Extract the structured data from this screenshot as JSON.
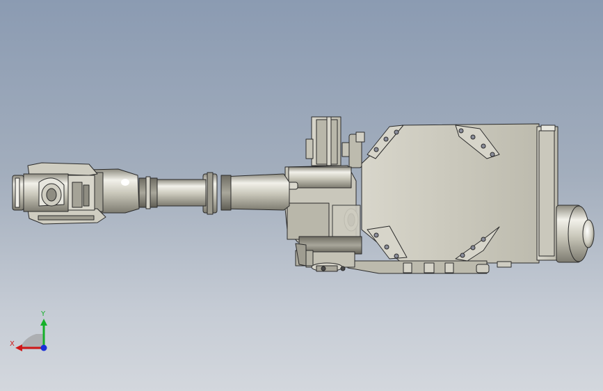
{
  "viewport": {
    "background_top": "#8b9bb2",
    "background_bottom": "#d3d7dd",
    "model_color": "#c8c6b8",
    "edge_color": "#2a2a2a"
  },
  "triad": {
    "x_label": "X",
    "y_label": "Y",
    "x_color": "#d01818",
    "y_color": "#16b02a",
    "z_color": "#1a2fd8"
  }
}
